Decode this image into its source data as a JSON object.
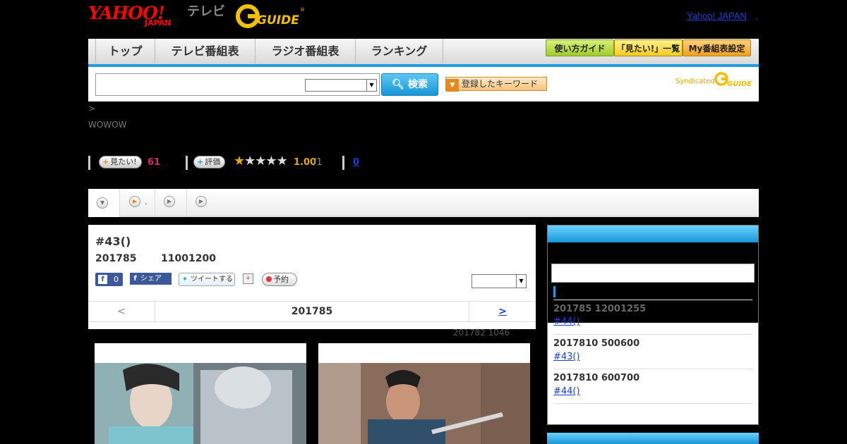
{
  "header": {
    "logo_yahoo": "YAHOO!",
    "logo_japan": "JAPAN",
    "logo_tv": "テレビ",
    "logo_gguide": "G GUIDE",
    "link_yahoo_japan": "Yahoo! JAPAN",
    "link_extra": ","
  },
  "nav": {
    "tabs": [
      "トップ",
      "テレビ番組表",
      "ラジオ番組表",
      "ランキング"
    ],
    "buttons": [
      "使い方ガイド",
      "「見たい!」一覧",
      "My番組表設定"
    ]
  },
  "search": {
    "input_value": "",
    "select_value": "",
    "button_label": "検索",
    "keyword_button": "登録したキーワード",
    "syndicated": "Syndicated",
    "syndicated_logo": "G GUIDE"
  },
  "breadcrumb": ">",
  "channel": "WOWOW",
  "stats": {
    "want_label": "見たい!",
    "want_count": "61",
    "rate_label": "評価",
    "stars_filled": 1,
    "stars_total": 5,
    "rating": "1.00",
    "rating_of": "/1",
    "review_count": "0"
  },
  "tabs_strip": [
    {
      "icon": "dropdown-icon",
      "label": ""
    },
    {
      "icon": "play-icon",
      "label": "."
    },
    {
      "icon": "play-icon",
      "label": ""
    },
    {
      "icon": "play-icon",
      "label": ""
    }
  ],
  "program": {
    "title": "#43()",
    "date": "201785",
    "time": "11001200",
    "like_count": "0",
    "share_label": "シェア",
    "tweet_label": "ツイートする",
    "reserve_label": "予約",
    "episode_select": "",
    "pager_prev": "<",
    "pager_date": "201785",
    "pager_next": ">",
    "updated": "201782  1046"
  },
  "sidebar": {
    "input_value": "",
    "items": [
      {
        "date": "201785  12001255",
        "episode": "#44()"
      },
      {
        "date": "2017810  500600",
        "episode": "#43()"
      },
      {
        "date": "2017810  600700",
        "episode": "#44()"
      }
    ]
  },
  "colors": {
    "accent_blue": "#1e9ee0",
    "rating_orange": "#e8a800",
    "want_pink": "#d62a6a",
    "link_blue": "#1a3fd6"
  }
}
